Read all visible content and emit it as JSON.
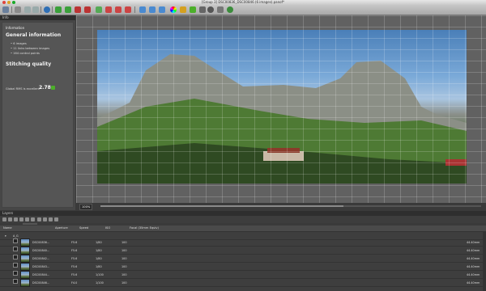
{
  "window": {
    "title": "[Group 3] DSC00836_DSC00846 (6 images).panof*"
  },
  "toolbar": {
    "icons": [
      "new-icon",
      "open-icon",
      "undo-icon",
      "redo-icon",
      "globe-icon",
      "add-icon",
      "select-icon",
      "crop-icon",
      "move-icon",
      "rotate-icon",
      "grid-icon",
      "control-points-icon",
      "optimize-icon",
      "mask-icon",
      "color-icon",
      "render-icon",
      "settings-icon",
      "tools-icon",
      "info-icon"
    ]
  },
  "left_panel": {
    "header": "Info",
    "section_label": "Information",
    "general_title": "General information",
    "bullets": [
      "6 images",
      "11 links between images",
      "164 control points"
    ],
    "stitching_title": "Stitching quality",
    "quality_label": "Global RMS is excellent",
    "quality_value": "2.78",
    "tabs": [
      "Info",
      "Histo"
    ]
  },
  "preview": {
    "zoom_label": "100%"
  },
  "layers": {
    "header": "Layers",
    "columns": [
      "Name",
      "Aperture",
      "Speed",
      "ISO",
      "Focal (35mm Equiv)"
    ],
    "group_name": "A_G",
    "rows": [
      {
        "name": "DSC00836...",
        "aperture": "F5.6",
        "speed": "1/80",
        "iso": "100",
        "focal": "44.40mm"
      },
      {
        "name": "DSC00840...",
        "aperture": "F5.6",
        "speed": "1/80",
        "iso": "100",
        "focal": "44.40mm"
      },
      {
        "name": "DSC00842...",
        "aperture": "F5.6",
        "speed": "1/80",
        "iso": "100",
        "focal": "44.40mm"
      },
      {
        "name": "DSC00843...",
        "aperture": "F5.6",
        "speed": "1/80",
        "iso": "100",
        "focal": "44.40mm"
      },
      {
        "name": "DSC00844...",
        "aperture": "F5.6",
        "speed": "1/100",
        "iso": "100",
        "focal": "44.40mm"
      },
      {
        "name": "DSC00846...",
        "aperture": "F4.0",
        "speed": "1/100",
        "iso": "100",
        "focal": "44.40mm"
      }
    ]
  },
  "colors": {
    "accent_green": "#4caf2a",
    "panel_bg": "#474747",
    "header_bg": "#2e2e2e"
  }
}
